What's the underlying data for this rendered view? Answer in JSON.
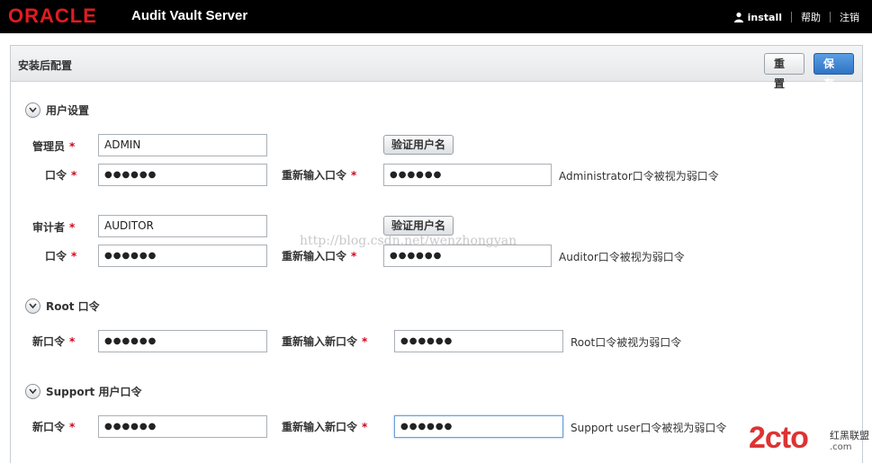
{
  "header": {
    "logo": "ORACLE",
    "app_name": "Audit Vault Server",
    "user": "install",
    "help": "帮助",
    "logout": "注销"
  },
  "panel": {
    "title": "安装后配置",
    "reset_label": "重置",
    "save_label": "保存"
  },
  "sections": {
    "user_settings": {
      "title": "用户设置",
      "admin": {
        "label": "管理员",
        "value": "ADMIN",
        "verify_label": "验证用户名",
        "password_label": "口令",
        "password_value": "●●●●●●",
        "reenter_label": "重新输入口令",
        "reenter_value": "●●●●●●",
        "hint": "Administrator口令被视为弱口令"
      },
      "auditor": {
        "label": "审计者",
        "value": "AUDITOR",
        "verify_label": "验证用户名",
        "password_label": "口令",
        "password_value": "●●●●●●",
        "reenter_label": "重新输入口令",
        "reenter_value": "●●●●●●",
        "hint": "Auditor口令被视为弱口令"
      }
    },
    "root": {
      "title": "Root 口令",
      "new_label": "新口令",
      "new_value": "●●●●●●",
      "reenter_label": "重新输入新口令",
      "reenter_value": "●●●●●●",
      "hint": "Root口令被视为弱口令"
    },
    "support": {
      "title": "Support 用户口令",
      "new_label": "新口令",
      "new_value": "●●●●●●",
      "reenter_label": "重新输入新口令",
      "reenter_value": "●●●●●●",
      "hint": "Support user口令被视为弱口令"
    }
  },
  "watermark": "http://blog.csdn.net/wenzhongyan",
  "corner_logo": {
    "text": "2cto",
    "com": ".com",
    "sub": "红黑联盟"
  },
  "required_mark": "*",
  "colors": {
    "topbar": "#000000",
    "oracle_red": "#e01b22",
    "save_blue": "#2f73c4",
    "required": "#d0021b"
  }
}
